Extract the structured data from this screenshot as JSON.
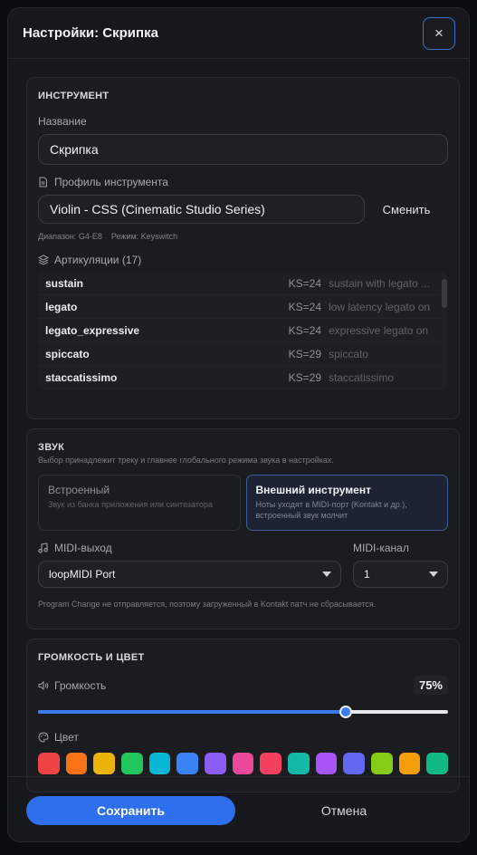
{
  "header": {
    "title": "Настройки: Скрипка",
    "close_label": "×"
  },
  "instrument": {
    "section_title": "ИНСТРУМЕНТ",
    "name_label": "Название",
    "name_value": "Скрипка",
    "profile_label": "Профиль инструмента",
    "profile_value": "Violin - CSS (Cinematic Studio Series)",
    "change_label": "Сменить",
    "range": "Диапазон: G4-E8",
    "mode": "Режим: Keyswitch",
    "articulations_label": "Артикуляции (17)",
    "articulations": [
      {
        "name": "sustain",
        "ks": "KS=24",
        "desc": "sustain with legato ..."
      },
      {
        "name": "legato",
        "ks": "KS=24",
        "desc": "low latency legato on"
      },
      {
        "name": "legato_expressive",
        "ks": "KS=24",
        "desc": "expressive legato on"
      },
      {
        "name": "spiccato",
        "ks": "KS=29",
        "desc": "spiccato"
      },
      {
        "name": "staccatissimo",
        "ks": "KS=29",
        "desc": "staccatissimo"
      }
    ]
  },
  "sound": {
    "section_title": "ЗВУК",
    "subtitle": "Выбор принадлежит треку и главнее глобального режима звука в настройках.",
    "options": [
      {
        "title": "Встроенный",
        "desc": "Звук из банка приложения или синтезатора",
        "active": false
      },
      {
        "title": "Внешний инструмент",
        "desc": "Ноты уходят в MIDI-порт (Kontakt и др.), встроенный звук молчит",
        "active": true
      }
    ],
    "midi_out_label": "MIDI-выход",
    "midi_out_value": "loopMIDI Port",
    "midi_channel_label": "MIDI-канал",
    "midi_channel_value": "1",
    "note": "Program Change не отправляется, поэтому загруженный в Kontakt патч не сбрасывается."
  },
  "volume": {
    "section_title": "ГРОМКОСТЬ И ЦВЕТ",
    "volume_label": "Громкость",
    "volume_text": "75%",
    "volume_fraction": 0.75,
    "color_label": "Цвет",
    "colors": [
      "#ef4444",
      "#f97316",
      "#eab308",
      "#22c55e",
      "#06b6d4",
      "#3b82f6",
      "#8b5cf6",
      "#ec4899",
      "#f43f5e",
      "#14b8a6",
      "#a855f7",
      "#6366f1",
      "#84cc16",
      "#f59e0b",
      "#10b981"
    ]
  },
  "footer": {
    "save_label": "Сохранить",
    "cancel_label": "Отмена"
  }
}
